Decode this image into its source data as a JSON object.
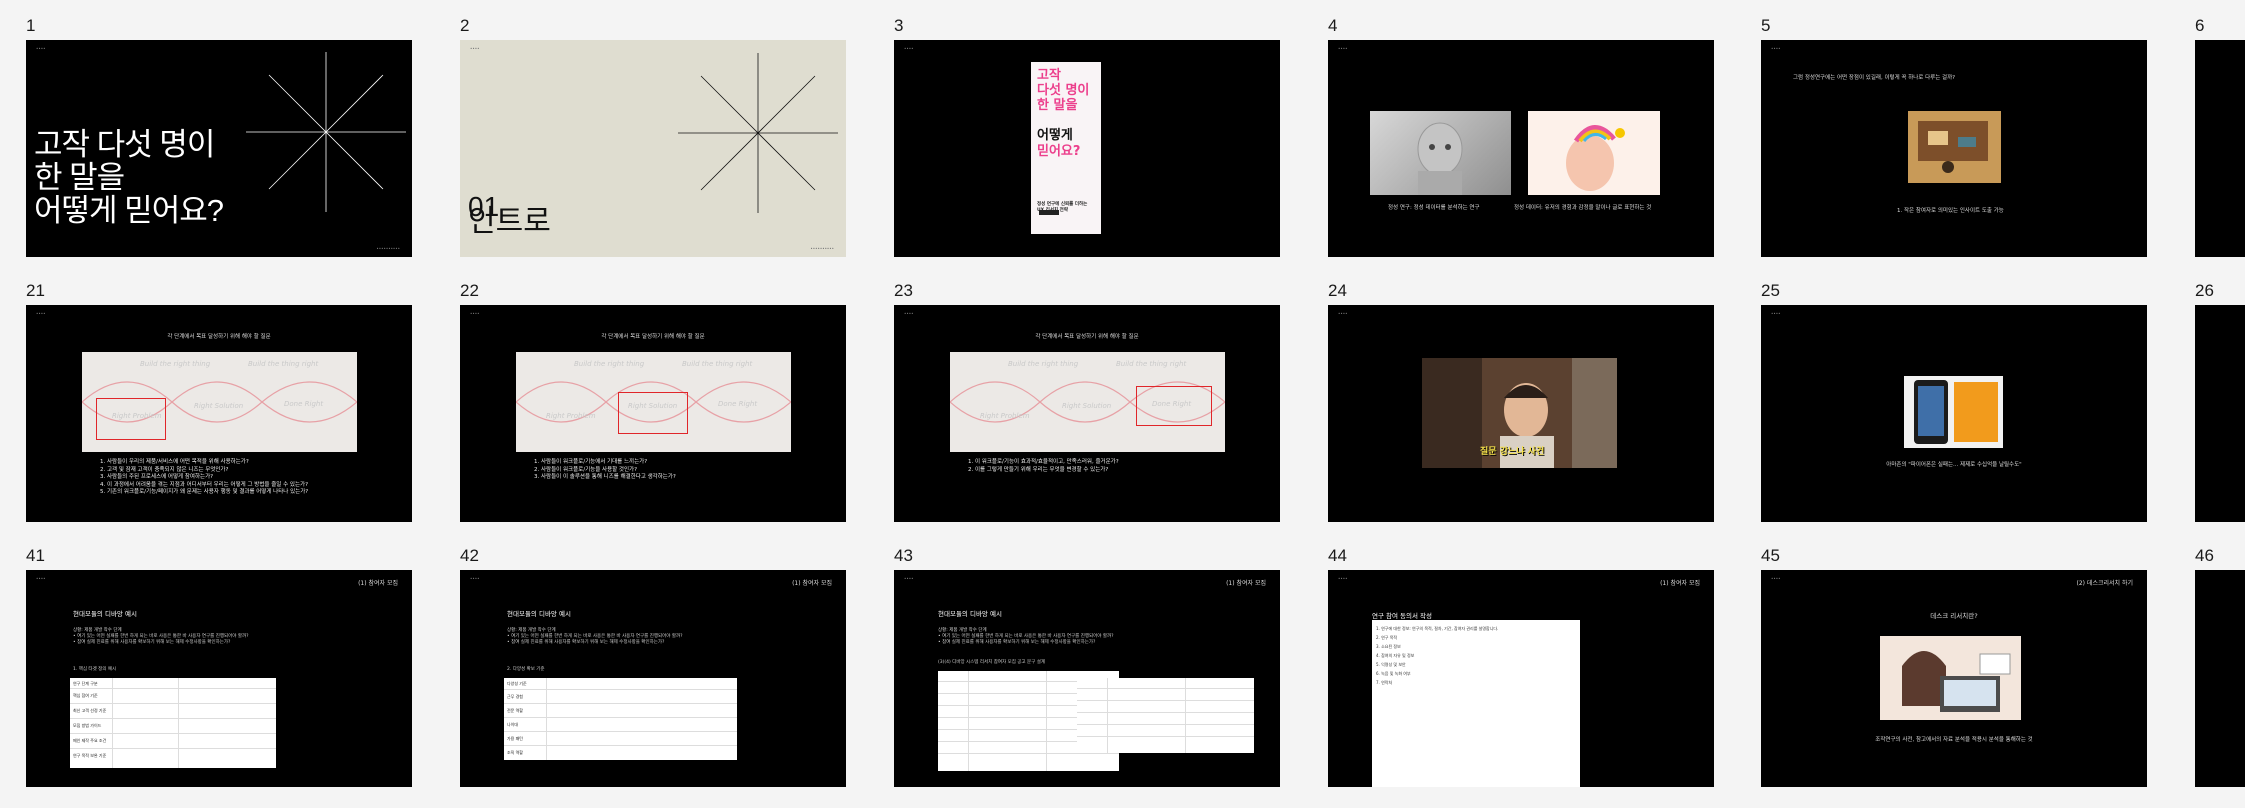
{
  "slides": [
    {
      "number": "1",
      "title": "고작 다섯 명이\n한 말을\n어떻게 믿어요?"
    },
    {
      "number": "2",
      "chapter_number": "01",
      "chapter_title": "인트로"
    },
    {
      "number": "3",
      "book": {
        "title_top": "고작\n다섯 명이\n한 말을",
        "title_mid": "어떻게",
        "title_bottom": "믿어요?",
        "subtitle": "정성 연구에 신뢰를 더하는\nUX 리서치 전략"
      }
    },
    {
      "number": "4",
      "caption_left": "정성 연구: 정성 데이터를 분석하는 연구",
      "caption_right": "정성 데이터: 유저의 경험과 감정을 말이나 글로 표현하는 것"
    },
    {
      "number": "5",
      "question": "그럼 정성연구에는 어떤 장점이 있길래, 이렇게 꼭 하나로 다루는 걸까?",
      "caption": "1. 작은 참여자로 의미있는 인사이트 도출 가능"
    },
    {
      "number": "6"
    },
    {
      "number": "21",
      "heading": "각 단계에서 목표 달성하기 위해 해야 할 질문",
      "questions": "1. 사람들이 우리의 제품/서비스에 어떤 목적을 위해 사용하는가?\n2. 고객 및 잠재 고객이 충족되지 않은 니즈는 무엇인가?\n3. 사람들의 주된 프로세스에 어떻게 참여하는가?\n4. 이 과정에서 어려움을 겪는 지점과 어디서부터 우리는 어떻게 그 방법을 줄일 수 있는가?\n5. 기존의 워크플로/기능/페이지가 왜 문제는 사용자 행동 및 결과를 어떻게 나타나 있는가?"
    },
    {
      "number": "22",
      "heading": "각 단계에서 목표 달성하기 위해 해야 할 질문",
      "questions": "1. 사람들이 워크플로/기능에서 기대를 느끼는가?\n2. 사람들이 워크플로/기능을 사용할 것인가?\n3. 사람들이 이 솔루션을 통해 니즈를 해결한다고 생각하는가?"
    },
    {
      "number": "23",
      "heading": "각 단계에서 목표 달성하기 위해 해야 할 질문",
      "questions": "1. 이 워크플로/기능이 효과적/효율적이고, 만족스러워, 즐거운가?\n2. 이를 그렇게 만들기 위해 우리는 무엇을 변경할 수 있는가?"
    },
    {
      "number": "24",
      "banner": "질문 강느냐 사건"
    },
    {
      "number": "25",
      "caption": "아마존의 \"파이어폰은 실패는... 제제로 수십억을 날릴수도\""
    },
    {
      "number": "26"
    },
    {
      "number": "41",
      "tag": "(1) 참여자 모집",
      "doc_title": "현대모듈의 디바앙 예시",
      "doc_text": "상황: 제품 개발 착수 단계\n• 여기 있는 어떤 실패를 한번 하게 되는 바로 사용은 통한 바 사용자 연구를 진행되어야 할까?\n• 참여 실제 진료를 위해 사용자를 확보하기 위해 보는 해제 수정사항을 확인하는가?",
      "section": "1. 핵심 타겟 정의 예시",
      "table_rows": [
        "연구 단계 구분",
        "핵심 참여 기준",
        "최신 고객 선정 기준",
        "모집 방법 가이드",
        "메인 제작 주요 조건",
        "연구 목적 보완 기준"
      ]
    },
    {
      "number": "42",
      "tag": "(1) 참여자 모집",
      "doc_title": "현대모듈의 디바앙 예시",
      "doc_text": "상황: 제품 개발 착수 단계\n• 여기 있는 어떤 실패를 한번 하게 되는 바로 사용은 통한 바 사용자 연구를 진행되어야 할까?\n• 참여 실제 진료를 위해 사용자를 확보하기 위해 보는 해제 수정사항을 확인하는가?",
      "section": "2. 다양성 확보 기준",
      "table_rows": [
        "다양성 기준",
        "근무 경험",
        "전문 역할",
        "나이대",
        "가용 패턴",
        "조직 역할"
      ]
    },
    {
      "number": "43",
      "tag": "(1) 참여자 모집",
      "doc_title": "현대모듈의 디바앙 예시",
      "doc_text": "상황: 제품 개발 착수 단계\n• 여기 있는 어떤 실패를 한번 하게 되는 바로 사용은 통한 바 사용자 연구를 진행되어야 할까?\n• 참여 실제 진료를 위해 사용자를 확보하기 위해 보는 해제 수정사항을 확인하는가?",
      "section": "(3)(4) 디바앙 시스템 리서치 참여자 모집 공고 문구 설계"
    },
    {
      "number": "44",
      "tag": "(1) 참여자 모집",
      "doc_title": "연구 참여 동의서 작성",
      "doc_text": "1. 연구에 대한 정보: 연구의 목적, 절차, 기간, 참여자 권리를 설명합니다.\n2. 연구 목적\n3. 소요된 정보\n4. 참여의 자유 및 정보\n5. 익명성 및 보안\n6. 녹음 및 녹화 여부\n7. 연락처"
    },
    {
      "number": "45",
      "tag": "(2) 데스크리서치 하기",
      "heading": "데스크 리서치란?",
      "caption": "조작연구의 사전, 참고에서의 자료 분석을 적용시 분석을 통해하는 것"
    },
    {
      "number": "46"
    }
  ],
  "colors": {
    "slide_bg": "#000000",
    "beige_bg": "#dfddd0",
    "accent_pink": "#ec3f8c",
    "highlight_red": "#e0262a"
  }
}
